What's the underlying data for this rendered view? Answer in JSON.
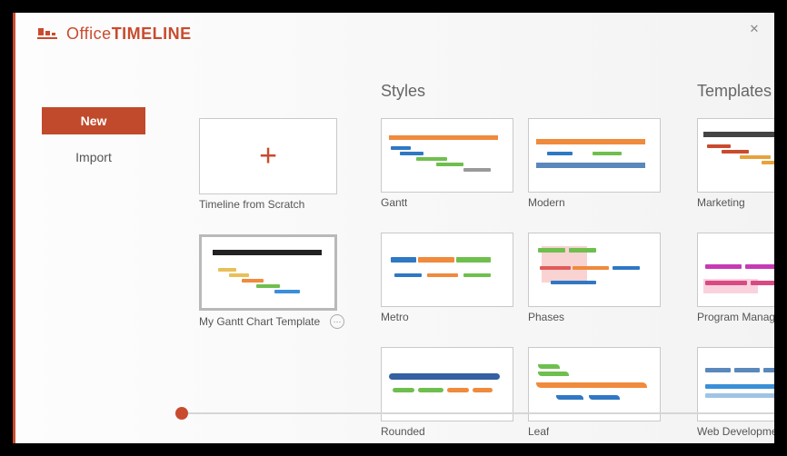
{
  "brand": {
    "light": "Office",
    "bold": "TIMELINE"
  },
  "nav": {
    "new": "New",
    "import": "Import"
  },
  "columns": {
    "styles_heading": "Styles",
    "templates_heading": "Templates"
  },
  "localTiles": {
    "scratch": "Timeline from Scratch",
    "myGantt": "My Gantt Chart Template"
  },
  "styles": {
    "gantt": "Gantt",
    "modern": "Modern",
    "metro": "Metro",
    "phases": "Phases",
    "rounded": "Rounded",
    "leaf": "Leaf"
  },
  "templates": {
    "marketing": "Marketing",
    "program": "Program Management",
    "webdev": "Web Development Plan"
  },
  "moreGlyph": "⋯"
}
